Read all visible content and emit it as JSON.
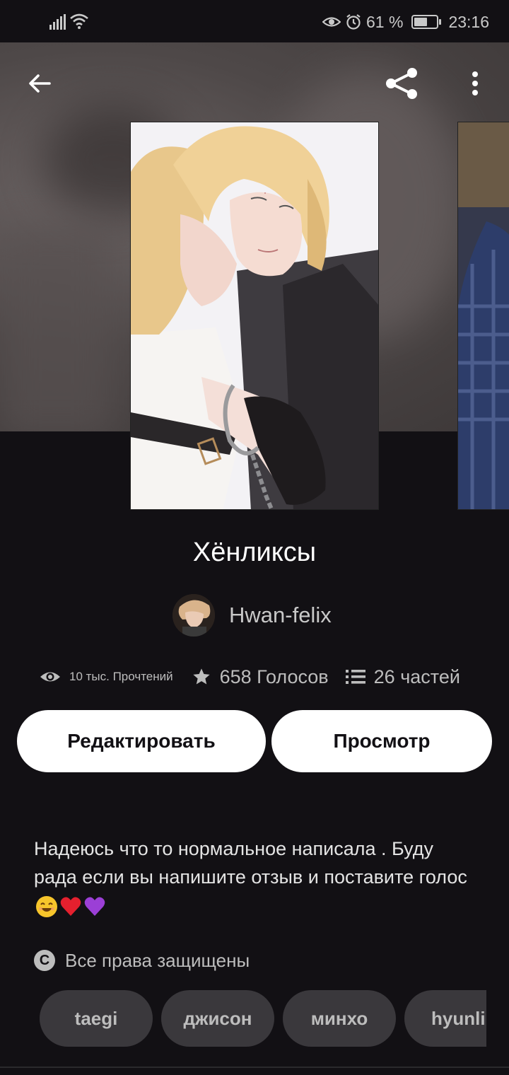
{
  "status_bar": {
    "battery_percent": "61 %",
    "battery_level": 0.61,
    "time": "23:16",
    "icons": [
      "signal-icon",
      "wifi-icon",
      "eye-icon",
      "alarm-icon",
      "battery-icon"
    ]
  },
  "toolbar": {
    "back_icon": "arrow-left-icon",
    "share_icon": "share-icon",
    "more_icon": "more-vertical-icon"
  },
  "story": {
    "title": "Хёнликсы",
    "author": "Hwan-felix",
    "reads": "10 тыс. Прочтений",
    "votes": "658 Голосов",
    "parts": "26 частей",
    "description": "Надеюсь что то нормальное написала . Буду рада если вы напишите отзыв и поставите голос",
    "description_emojis": [
      "smiling-face-emoji",
      "red-heart-emoji",
      "purple-heart-emoji"
    ],
    "copyright": "Все права защищены"
  },
  "actions": {
    "edit_label": "Редактировать",
    "view_label": "Просмотр"
  },
  "tags": [
    "taegi",
    "джисон",
    "минхо",
    "hyunli"
  ],
  "colors": {
    "background": "#121014",
    "button_bg": "#ffffff",
    "tag_bg": "#3a383c",
    "muted_text": "#bdbdbd"
  }
}
